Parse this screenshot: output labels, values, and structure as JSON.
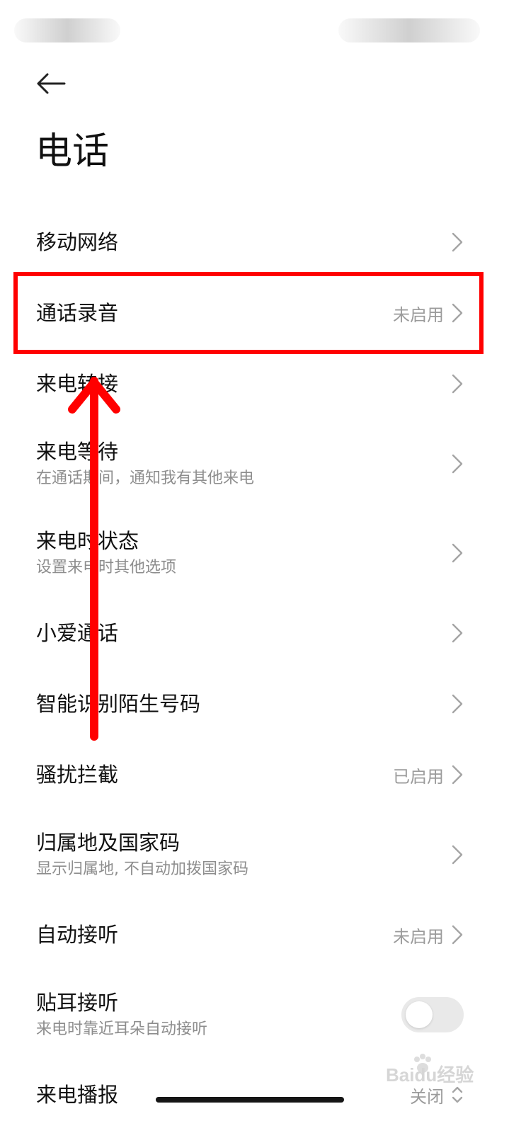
{
  "header": {
    "title": "电话"
  },
  "settings": [
    {
      "title": "移动网络",
      "control": "chevron"
    },
    {
      "title": "通话录音",
      "value": "未启用",
      "control": "chevron",
      "highlighted": true
    },
    {
      "title": "来电转接",
      "control": "chevron"
    },
    {
      "title": "来电等待",
      "subtitle": "在通话期间，通知我有其他来电",
      "control": "chevron"
    },
    {
      "title": "来电时状态",
      "subtitle": "设置来电时其他选项",
      "control": "chevron"
    },
    {
      "title": "小爱通话",
      "control": "chevron"
    },
    {
      "title": "智能识别陌生号码",
      "control": "chevron"
    },
    {
      "title": "骚扰拦截",
      "value": "已启用",
      "control": "chevron"
    },
    {
      "title": "归属地及国家码",
      "subtitle": "显示归属地, 不自动加拨国家码",
      "control": "chevron"
    },
    {
      "title": "自动接听",
      "value": "未启用",
      "control": "chevron"
    },
    {
      "title": "贴耳接听",
      "subtitle": "来电时靠近耳朵自动接听",
      "control": "toggle",
      "toggle_on": false
    },
    {
      "title": "来电播报",
      "value": "关闭",
      "control": "dropdown"
    }
  ],
  "watermark": {
    "text": "Baidu经验"
  },
  "colors": {
    "annotation": "#ff0000",
    "subtitle": "#8d8d8d",
    "value": "#9b9b9b"
  },
  "icons": {
    "back": "arrow-left-icon",
    "row": "chevron-right-icon",
    "dropdown": "chevron-updown-icon"
  }
}
